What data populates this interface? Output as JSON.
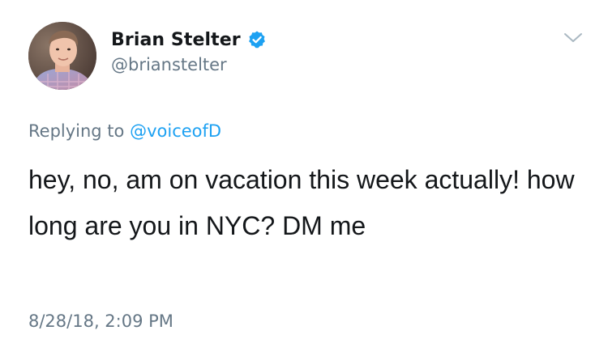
{
  "author": {
    "display_name": "Brian Stelter",
    "handle": "@brianstelter",
    "verified": true,
    "verified_badge_color": "#1da1f2"
  },
  "reply": {
    "prefix": "Replying to ",
    "mention": "@voiceofD",
    "mention_color": "#1da1f2"
  },
  "tweet": {
    "text": "hey, no, am on vacation this week actually! how long are you in NYC? DM me",
    "timestamp": "8/28/18, 2:09 PM"
  },
  "icons": {
    "menu": "chevron-down-icon",
    "verified": "verified-badge-icon",
    "avatar": "profile-photo"
  },
  "colors": {
    "text": "#14171a",
    "secondary": "#657786",
    "accent": "#1da1f2"
  }
}
